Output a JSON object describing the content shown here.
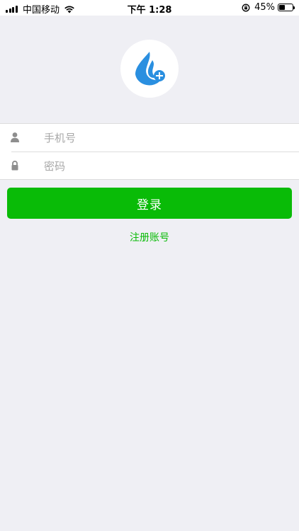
{
  "status_bar": {
    "carrier": "中国移动",
    "time": "下午 1:28",
    "battery_percent": "45%",
    "battery_level": 0.45
  },
  "form": {
    "phone_placeholder": "手机号",
    "password_placeholder": "密码",
    "phone_value": "",
    "password_value": ""
  },
  "actions": {
    "login_label": "登录",
    "register_label": "注册账号"
  },
  "colors": {
    "accent_green": "#09bb07",
    "logo_blue": "#2a8fe0",
    "background": "#efeff4"
  },
  "icons": {
    "logo": "water-drop-plus-icon",
    "phone_field": "user-icon",
    "password_field": "lock-icon"
  }
}
